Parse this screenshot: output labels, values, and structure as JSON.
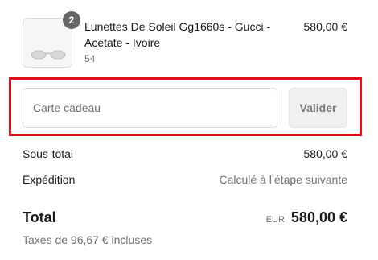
{
  "product": {
    "quantity": "2",
    "name": "Lunettes De Soleil Gg1660s - Gucci - Acétate - Ivoire",
    "variant": "54",
    "price": "580,00 €",
    "thumbnail_icon": "sunglasses-icon"
  },
  "gift_card": {
    "placeholder": "Carte cadeau",
    "value": "",
    "apply_label": "Valider",
    "highlight_color": "#e0101a"
  },
  "summary": {
    "subtotal_label": "Sous-total",
    "subtotal_value": "580,00 €",
    "shipping_label": "Expédition",
    "shipping_value": "Calculé à l’étape suivante",
    "total_label": "Total",
    "currency": "EUR",
    "total_value": "580,00 €",
    "taxes_note": "Taxes de 96,67 € incluses"
  }
}
